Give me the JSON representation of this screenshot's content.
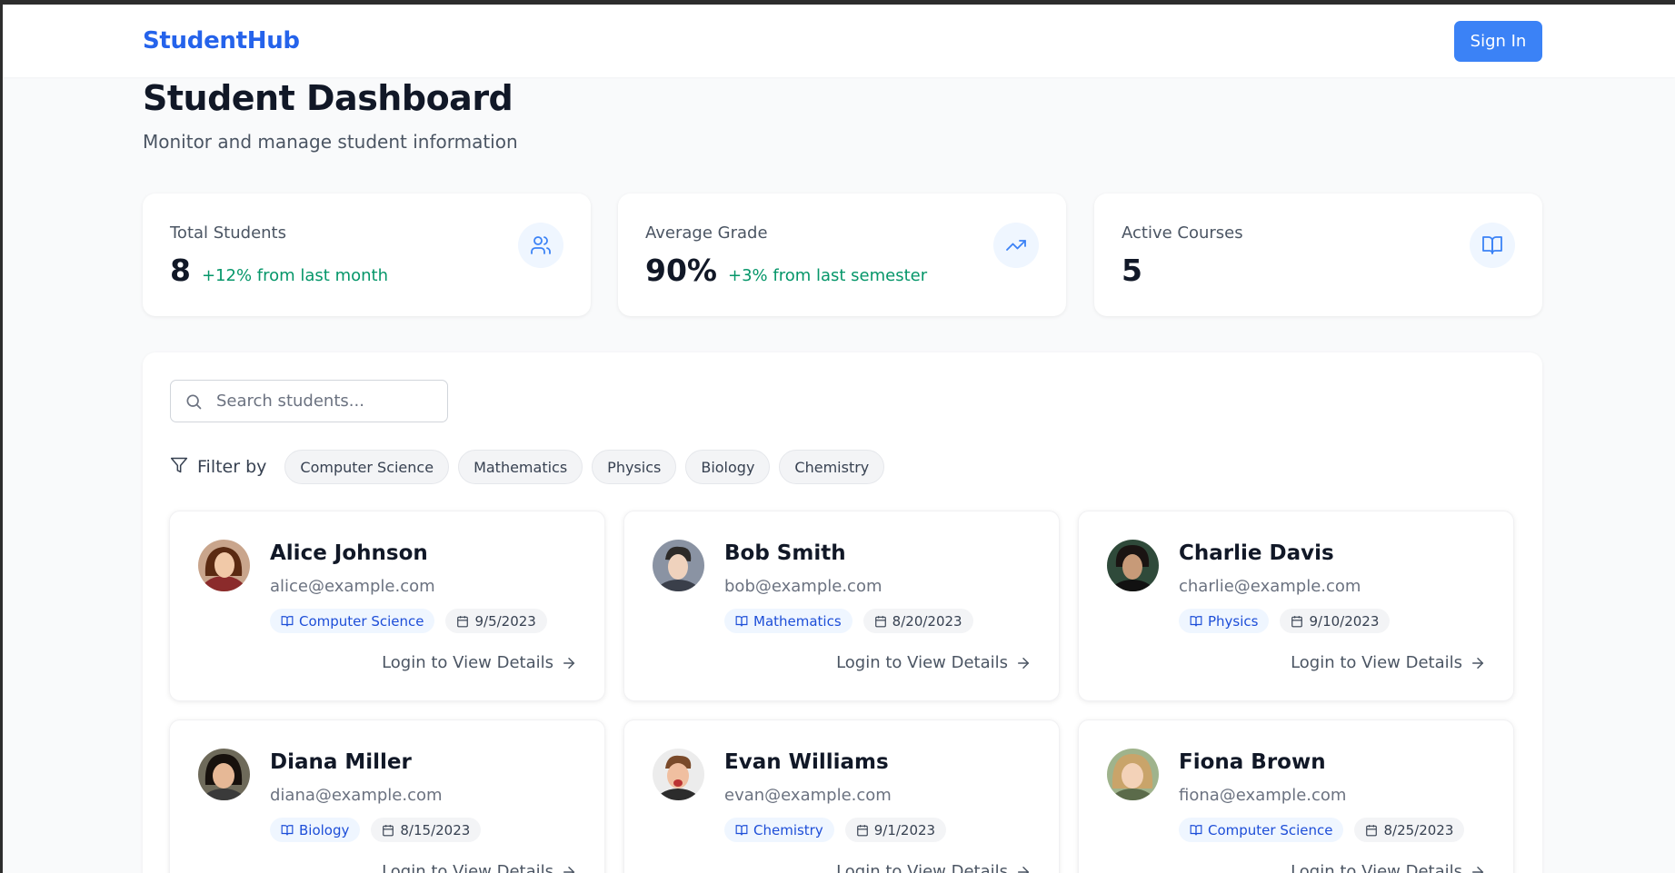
{
  "header": {
    "brand": "StudentHub",
    "signin_label": "Sign In"
  },
  "page": {
    "title": "Student Dashboard",
    "subtitle": "Monitor and manage student information"
  },
  "stats": [
    {
      "label": "Total Students",
      "value": "8",
      "change": "+12% from last month",
      "icon": "users-icon"
    },
    {
      "label": "Average Grade",
      "value": "90%",
      "change": "+3% from last semester",
      "icon": "trending-up-icon"
    },
    {
      "label": "Active Courses",
      "value": "5",
      "change": "",
      "icon": "book-open-icon"
    }
  ],
  "search": {
    "placeholder": "Search students...",
    "value": ""
  },
  "filter": {
    "label": "Filter by",
    "options": [
      "Computer Science",
      "Mathematics",
      "Physics",
      "Biology",
      "Chemistry"
    ]
  },
  "students": [
    {
      "name": "Alice Johnson",
      "email": "alice@example.com",
      "course": "Computer Science",
      "date": "9/5/2023",
      "link": "Login to View Details"
    },
    {
      "name": "Bob Smith",
      "email": "bob@example.com",
      "course": "Mathematics",
      "date": "8/20/2023",
      "link": "Login to View Details"
    },
    {
      "name": "Charlie Davis",
      "email": "charlie@example.com",
      "course": "Physics",
      "date": "9/10/2023",
      "link": "Login to View Details"
    },
    {
      "name": "Diana Miller",
      "email": "diana@example.com",
      "course": "Biology",
      "date": "8/15/2023",
      "link": "Login to View Details"
    },
    {
      "name": "Evan Williams",
      "email": "evan@example.com",
      "course": "Chemistry",
      "date": "9/1/2023",
      "link": "Login to View Details"
    },
    {
      "name": "Fiona Brown",
      "email": "fiona@example.com",
      "course": "Computer Science",
      "date": "8/25/2023",
      "link": "Login to View Details"
    }
  ],
  "colors": {
    "brand": "#2563eb",
    "button": "#3b82f6",
    "positive": "#059669",
    "course_tag_bg": "#eff6ff",
    "course_tag_text": "#1d4ed8"
  }
}
